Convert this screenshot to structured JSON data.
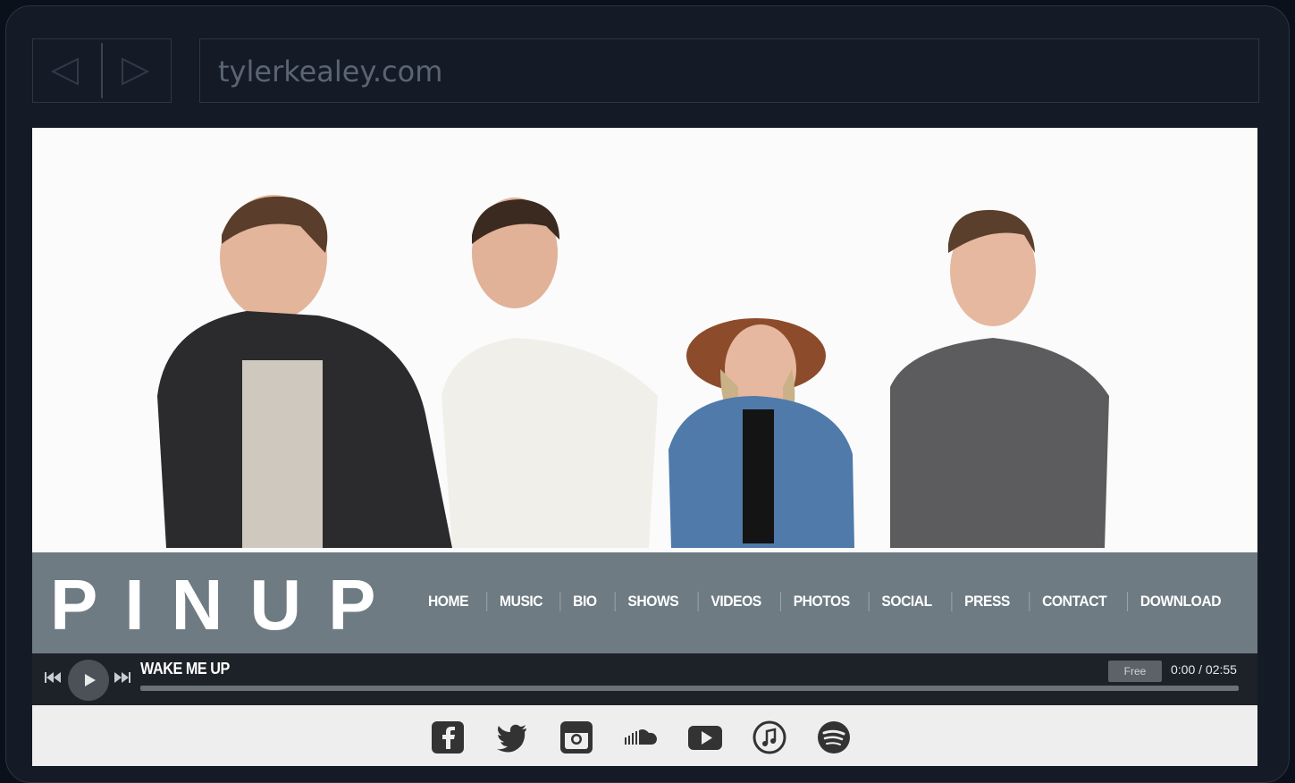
{
  "browser": {
    "url": "tylerkealey.com"
  },
  "site": {
    "logo": "PINUP",
    "nav": [
      "HOME",
      "MUSIC",
      "BIO",
      "SHOWS",
      "VIDEOS",
      "PHOTOS",
      "SOCIAL",
      "PRESS",
      "CONTACT",
      "DOWNLOAD"
    ]
  },
  "player": {
    "track_title": "WAKE ME UP",
    "free_label": "Free",
    "time": "0:00 / 02:55",
    "progress": 0
  },
  "social_icons": [
    "facebook-icon",
    "twitter-icon",
    "instagram-icon",
    "soundcloud-icon",
    "youtube-icon",
    "music-note-icon",
    "spotify-icon"
  ],
  "colors": {
    "frame_bg": "#141b27",
    "nav_band": "#4e5e68",
    "player_bg": "#1d2228",
    "social_bg": "#eeeeee",
    "icon": "#333333"
  }
}
